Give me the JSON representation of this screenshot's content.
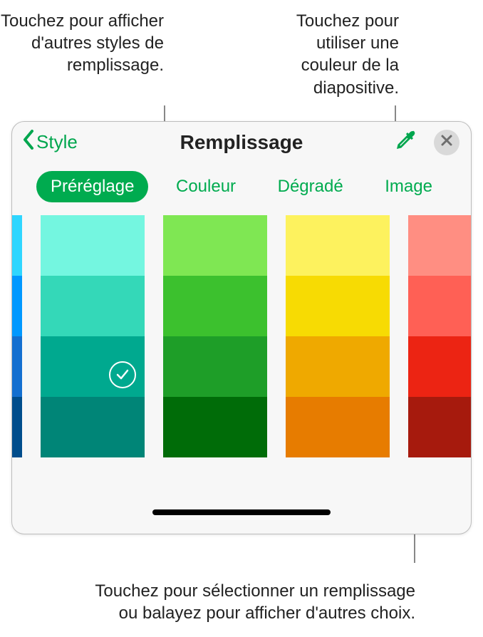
{
  "callouts": {
    "top_left": "Touchez pour afficher d'autres styles de remplissage.",
    "top_right": "Touchez pour utiliser une couleur de la diapositive.",
    "bottom": "Touchez pour sélectionner un remplissage ou balayez pour afficher d'autres choix."
  },
  "popover": {
    "back_label": "Style",
    "title": "Remplissage",
    "icons": {
      "eyedropper": "eyedropper-icon",
      "close": "close-icon"
    },
    "tabs": {
      "preset": "Préréglage",
      "color": "Couleur",
      "gradient": "Dégradé",
      "image": "Image"
    },
    "swatches": {
      "col0": [
        "#2fd6ff",
        "#0098ff",
        "#136fd0",
        "#004d8c"
      ],
      "col1": [
        "#74f6e0",
        "#34d8b8",
        "#00a98f",
        "#008577"
      ],
      "col2": [
        "#7fe753",
        "#3cc12e",
        "#1e9e28",
        "#006c08"
      ],
      "col3": [
        "#fdf25e",
        "#f7db03",
        "#efa900",
        "#e77c00"
      ],
      "col4": [
        "#ff8e82",
        "#ff6055",
        "#ec2413",
        "#a61a0d"
      ]
    },
    "selected": {
      "col": 1,
      "row": 2
    }
  },
  "accent": "#00ab4f"
}
